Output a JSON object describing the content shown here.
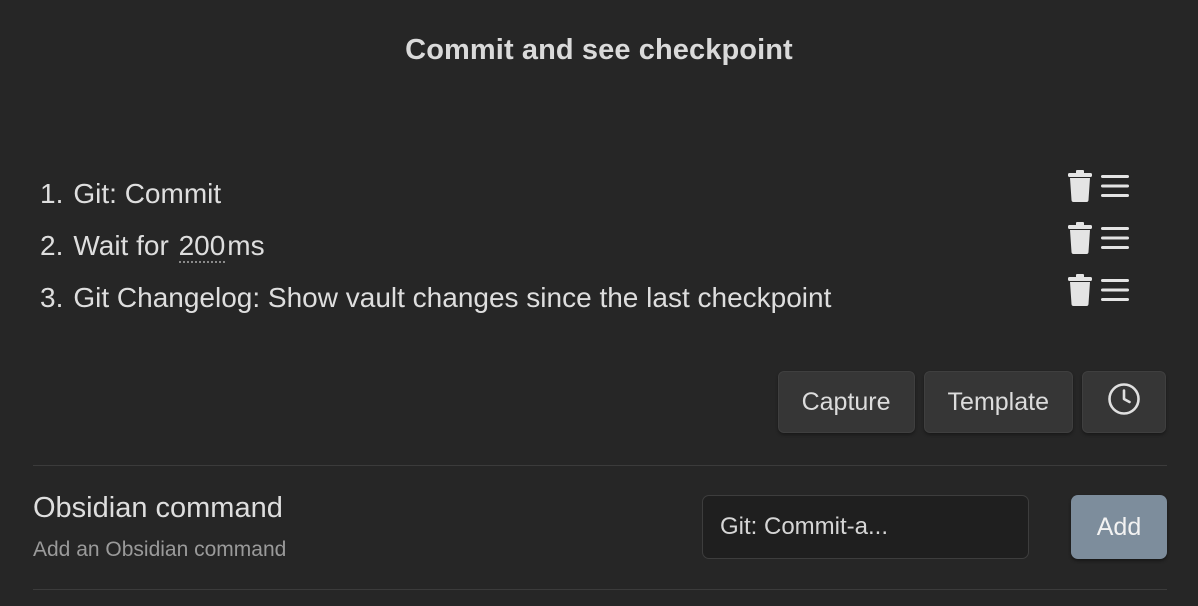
{
  "modal": {
    "title": "Commit and see checkpoint"
  },
  "steps": [
    {
      "number": "1.",
      "text": "Git: Commit"
    },
    {
      "number": "2.",
      "prefix": "Wait for ",
      "delay": "200",
      "suffix": "ms"
    },
    {
      "number": "3.",
      "text": "Git Changelog: Show vault changes since the last checkpoint"
    }
  ],
  "step_icons": {
    "delete": "trash-icon",
    "reorder": "drag-handle-icon"
  },
  "buttons": {
    "capture": "Capture",
    "template": "Template",
    "clock_icon": "clock-icon"
  },
  "setting": {
    "name": "Obsidian command",
    "description": "Add an Obsidian command",
    "input_value": "Git: Commit-a...",
    "add_label": "Add"
  },
  "colors": {
    "background": "#262626",
    "accent_button": "#7d8d9c"
  }
}
